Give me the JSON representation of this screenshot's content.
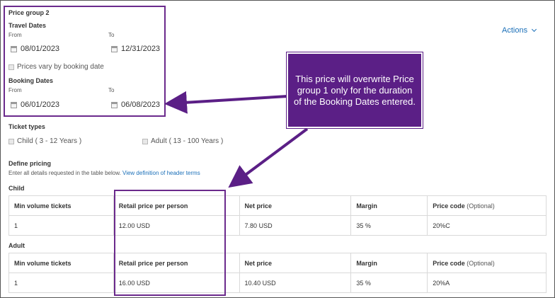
{
  "price_group": {
    "title": "Price group 2",
    "travel_dates": {
      "label": "Travel Dates",
      "from_label": "From",
      "to_label": "To",
      "from": "08/01/2023",
      "to": "12/31/2023"
    },
    "vary_checkbox_label": "Prices vary by booking date",
    "booking_dates": {
      "label": "Booking Dates",
      "from_label": "From",
      "to_label": "To",
      "from": "06/01/2023",
      "to": "06/08/2023"
    }
  },
  "actions_label": "Actions",
  "callout_text": "This price will overwrite Price group 1 only for the duration of the Booking Dates entered.",
  "ticket_types": {
    "label": "Ticket types",
    "child": "Child ( 3 - 12 Years )",
    "adult": "Adult ( 13 - 100 Years )"
  },
  "define_pricing": {
    "label": "Define pricing",
    "description": "Enter all details requested in the table below.",
    "link": "View definition of header terms"
  },
  "table_headers": {
    "min_volume": "Min volume tickets",
    "retail": "Retail price per person",
    "net": "Net price",
    "margin": "Margin",
    "price_code": "Price code",
    "optional": "(Optional)"
  },
  "child": {
    "label": "Child",
    "min_volume": "1",
    "retail": "12.00 USD",
    "net": "7.80 USD",
    "margin": "35 %",
    "price_code": "20%C"
  },
  "adult": {
    "label": "Adult",
    "min_volume": "1",
    "retail": "16.00 USD",
    "net": "10.40 USD",
    "margin": "35 %",
    "price_code": "20%A"
  },
  "colors": {
    "annotation_purple": "#5b1f86",
    "link_blue": "#1a6fb8"
  }
}
